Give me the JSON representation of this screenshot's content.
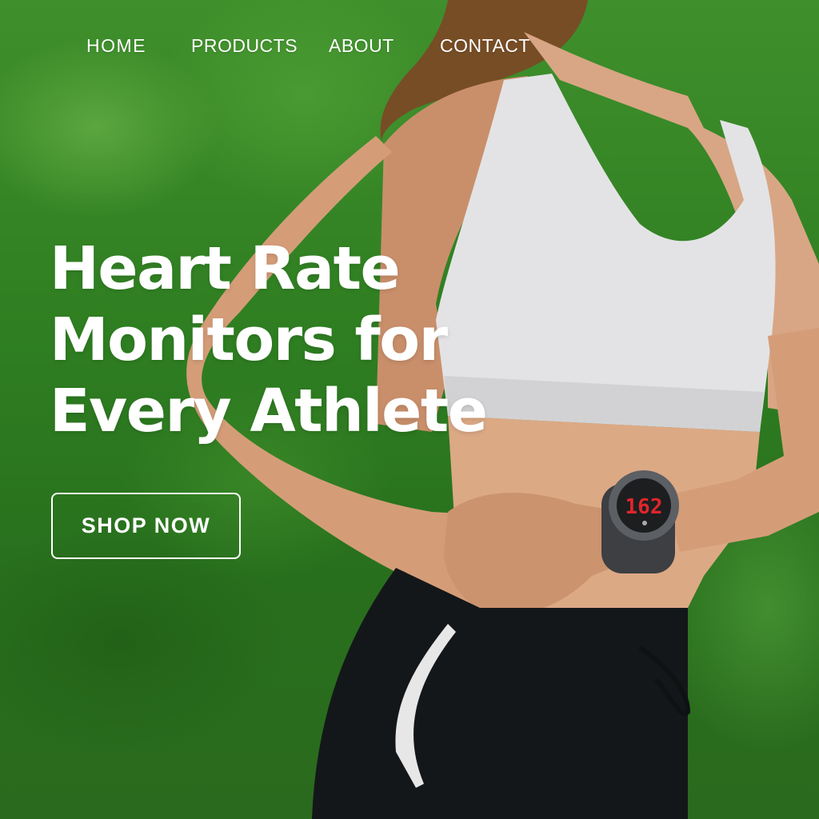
{
  "nav": {
    "items": [
      {
        "label": "HOME"
      },
      {
        "label": "PRODUCTS"
      },
      {
        "label": "ABOUT"
      },
      {
        "label": "CONTACT"
      }
    ]
  },
  "hero": {
    "headline_lines": [
      "Heart Rate",
      "Monitors for",
      "Every Athlete"
    ],
    "cta_label": "SHOP NOW",
    "watch_display": "162"
  },
  "colors": {
    "background_green": "#2f7a23",
    "text": "#ffffff",
    "watch_digits": "#e0262b"
  }
}
